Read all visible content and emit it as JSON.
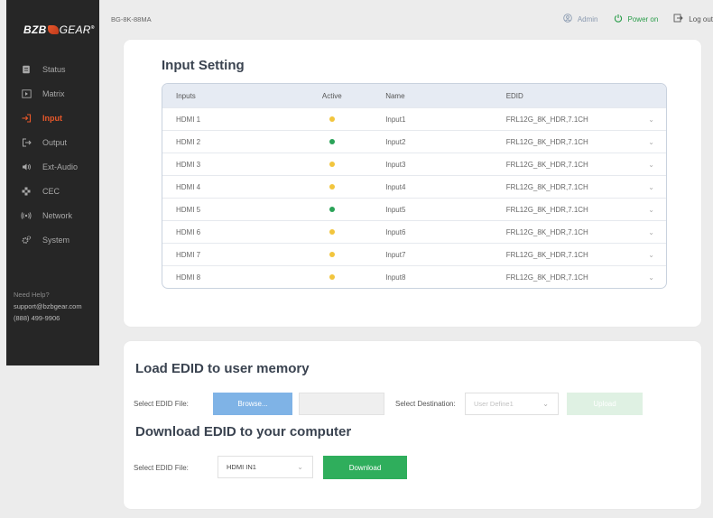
{
  "brand": {
    "logo_a": "BZB",
    "logo_b": "GEAR",
    "logo_mark": "®"
  },
  "device": "BG-8K-88MA",
  "topbar": {
    "admin": "Admin",
    "power": "Power on",
    "logout": "Log out"
  },
  "colors": {
    "accent": "#e8582a",
    "power": "#2a9d4a",
    "browse": "#7fb3e6",
    "download": "#2fae5c",
    "dot_yellow": "#f2c53d",
    "dot_green": "#2ba358"
  },
  "sidebar": {
    "items": [
      {
        "label": "Status",
        "icon": "status-icon"
      },
      {
        "label": "Matrix",
        "icon": "matrix-icon"
      },
      {
        "label": "Input",
        "icon": "input-icon"
      },
      {
        "label": "Output",
        "icon": "output-icon"
      },
      {
        "label": "Ext-Audio",
        "icon": "audio-icon"
      },
      {
        "label": "CEC",
        "icon": "cec-icon"
      },
      {
        "label": "Network",
        "icon": "network-icon"
      },
      {
        "label": "System",
        "icon": "system-icon"
      }
    ],
    "active": "Input",
    "help": {
      "title": "Need Help?",
      "email": "support@bzbgear.com",
      "phone": "(888) 499-9906"
    }
  },
  "input_setting": {
    "title": "Input Setting",
    "columns": [
      "Inputs",
      "Active",
      "Name",
      "EDID"
    ],
    "rows": [
      {
        "input": "HDMI 1",
        "active": "yellow",
        "name": "Input1",
        "edid": "FRL12G_8K_HDR,7.1CH"
      },
      {
        "input": "HDMI 2",
        "active": "green",
        "name": "Input2",
        "edid": "FRL12G_8K_HDR,7.1CH"
      },
      {
        "input": "HDMI 3",
        "active": "yellow",
        "name": "Input3",
        "edid": "FRL12G_8K_HDR,7.1CH"
      },
      {
        "input": "HDMI 4",
        "active": "yellow",
        "name": "Input4",
        "edid": "FRL12G_8K_HDR,7.1CH"
      },
      {
        "input": "HDMI 5",
        "active": "green",
        "name": "Input5",
        "edid": "FRL12G_8K_HDR,7.1CH"
      },
      {
        "input": "HDMI 6",
        "active": "yellow",
        "name": "Input6",
        "edid": "FRL12G_8K_HDR,7.1CH"
      },
      {
        "input": "HDMI 7",
        "active": "yellow",
        "name": "Input7",
        "edid": "FRL12G_8K_HDR,7.1CH"
      },
      {
        "input": "HDMI 8",
        "active": "yellow",
        "name": "Input8",
        "edid": "FRL12G_8K_HDR,7.1CH"
      }
    ]
  },
  "load_edid": {
    "title": "Load EDID to user memory",
    "file_label": "Select EDID File:",
    "browse_label": "Browse...",
    "dest_label": "Select Destination:",
    "dest_value": "User Define1",
    "upload_label": "Upload"
  },
  "download_edid": {
    "title": "Download EDID to your computer",
    "file_label": "Select EDID File:",
    "file_value": "HDMI IN1",
    "download_label": "Download"
  }
}
